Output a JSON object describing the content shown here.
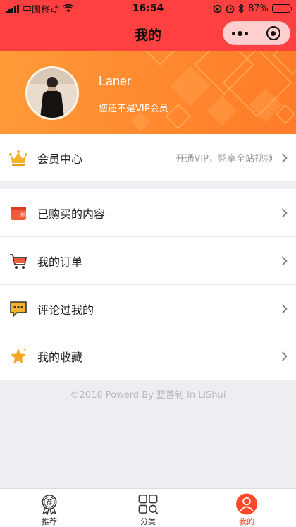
{
  "status_bar": {
    "carrier": "中国移动",
    "time": "16:54",
    "battery": "87%",
    "battery_level": 0.87
  },
  "nav": {
    "title": "我的"
  },
  "profile": {
    "username": "Laner",
    "vip_note": "您还不是VIP会员"
  },
  "vip_row": {
    "label": "会员中心",
    "hint": "开通VIP，畅享全站视频",
    "icon": "crown-icon"
  },
  "menu": [
    {
      "label": "已购买的内容",
      "icon": "wallet-icon"
    },
    {
      "label": "我的订单",
      "icon": "cart-icon"
    },
    {
      "label": "评论过我的",
      "icon": "comment-icon"
    },
    {
      "label": "我的收藏",
      "icon": "star-icon"
    }
  ],
  "footer": {
    "text": "©2018 Powerd By 蓝善钊 In LiShui"
  },
  "tabbar": {
    "items": [
      {
        "label": "推荐",
        "icon": "recommend-badge-icon"
      },
      {
        "label": "分类",
        "icon": "category-grid-icon"
      },
      {
        "label": "我的",
        "icon": "user-icon",
        "active": true
      }
    ]
  },
  "colors": {
    "brand_red": "#ff4040",
    "header_orange": "#ff8a2f",
    "active_tab": "#ff4a2a"
  }
}
